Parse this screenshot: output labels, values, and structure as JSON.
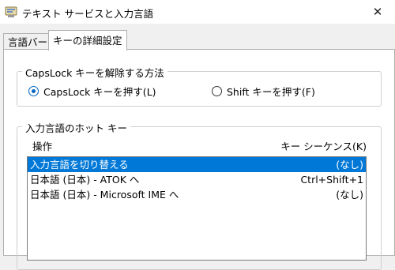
{
  "window": {
    "title": "テキスト サービスと入力言語",
    "close_glyph": "✕"
  },
  "tabs": [
    {
      "label": "言語バー",
      "active": false
    },
    {
      "label": "キーの詳細設定",
      "active": true
    }
  ],
  "capslock_group": {
    "label": "CapsLock キーを解除する方法",
    "options": [
      {
        "label": "CapsLock キーを押す(L)",
        "selected": true
      },
      {
        "label": "Shift キーを押す(F)",
        "selected": false
      }
    ]
  },
  "hotkey_group": {
    "label": "入力言語のホット キー",
    "col_action": "操作",
    "col_sequence": "キー シーケンス(K)",
    "rows": [
      {
        "action": "入力言語を切り替える",
        "sequence": "(なし)",
        "selected": true
      },
      {
        "action": "日本語 (日本) - ATOK へ",
        "sequence": "Ctrl+Shift+1",
        "selected": false
      },
      {
        "action": "日本語 (日本) - Microsoft IME へ",
        "sequence": "(なし)",
        "selected": false
      }
    ]
  },
  "colors": {
    "accent": "#0067c0",
    "selection": "#0078d7"
  }
}
